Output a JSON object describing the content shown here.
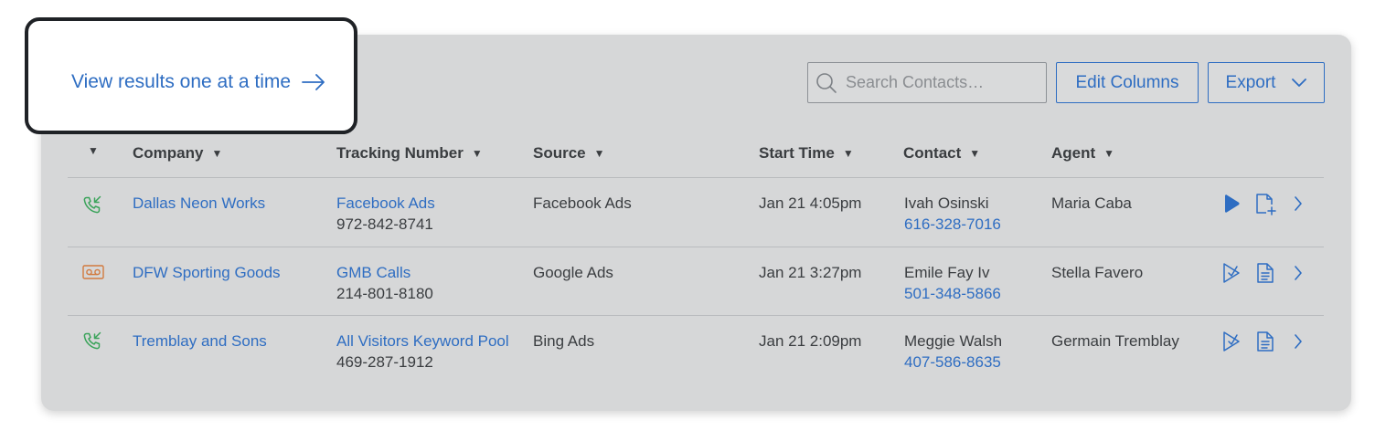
{
  "callout": {
    "label": "View results one at a time",
    "icon": "arrow-right-icon"
  },
  "toolbar": {
    "search_placeholder": "Search Contacts…",
    "edit_columns": "Edit Columns",
    "export": "Export"
  },
  "columns": [
    "Company",
    "Tracking Number",
    "Source",
    "Start Time",
    "Contact",
    "Agent"
  ],
  "rows": [
    {
      "type_icon": "incoming-call-icon",
      "company": "Dallas Neon Works",
      "tracking_source": "Facebook Ads",
      "tracking_number": "972-842-8741",
      "source": "Facebook Ads",
      "start_time": "Jan 21 4:05pm",
      "contact_name": "Ivah Osinski",
      "contact_phone": "616-328-7016",
      "agent": "Maria Caba",
      "actions": [
        "play-icon",
        "add-note-icon",
        "chevron-right-icon"
      ]
    },
    {
      "type_icon": "voicemail-icon",
      "company": "DFW Sporting Goods",
      "tracking_source": "GMB Calls",
      "tracking_number": "214-801-8180",
      "source": "Google Ads",
      "start_time": "Jan 21 3:27pm",
      "contact_name": "Emile Fay Iv",
      "contact_phone": "501-348-5866",
      "agent": "Stella Favero",
      "actions": [
        "scored-icon",
        "note-icon",
        "chevron-right-icon"
      ]
    },
    {
      "type_icon": "incoming-call-icon",
      "company": "Tremblay and Sons",
      "tracking_source": "All Visitors Keyword Pool",
      "tracking_number": "469-287-1912",
      "source": "Bing Ads",
      "start_time": "Jan 21 2:09pm",
      "contact_name": "Meggie Walsh",
      "contact_phone": "407-586-8635",
      "agent": "Germain Tremblay",
      "actions": [
        "scored-icon",
        "note-icon",
        "chevron-right-icon"
      ]
    }
  ],
  "colors": {
    "link": "#2e6dc2",
    "call_icon": "#3aa35a",
    "voicemail_icon": "#d27a3f",
    "panel_bg": "#d6d7d8",
    "callout_border": "#1f2226"
  }
}
